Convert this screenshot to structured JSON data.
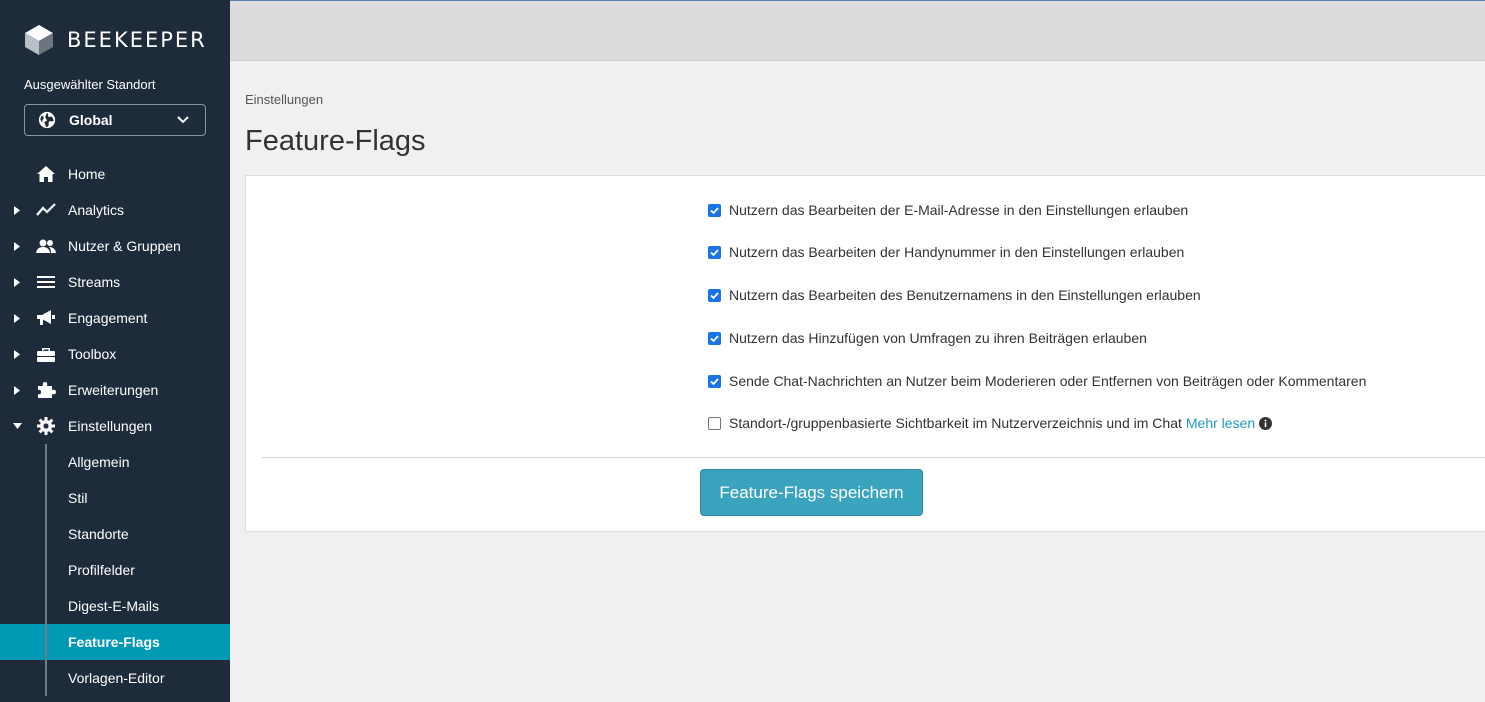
{
  "brand": {
    "name": "BEEKEEPER",
    "logo_icon": "cube-logo"
  },
  "location": {
    "label": "Ausgewählter Standort",
    "value": "Global"
  },
  "nav": [
    {
      "label": "Home",
      "icon": "home-icon"
    },
    {
      "label": "Analytics",
      "icon": "analytics-icon"
    },
    {
      "label": "Nutzer & Gruppen",
      "icon": "users-icon"
    },
    {
      "label": "Streams",
      "icon": "list-icon"
    },
    {
      "label": "Engagement",
      "icon": "megaphone-icon"
    },
    {
      "label": "Toolbox",
      "icon": "toolbox-icon"
    },
    {
      "label": "Erweiterungen",
      "icon": "puzzle-icon"
    },
    {
      "label": "Einstellungen",
      "icon": "gear-icon"
    }
  ],
  "subnav": [
    {
      "label": "Allgemein"
    },
    {
      "label": "Stil"
    },
    {
      "label": "Standorte"
    },
    {
      "label": "Profilfelder"
    },
    {
      "label": "Digest-E-Mails"
    },
    {
      "label": "Feature-Flags",
      "active": true
    },
    {
      "label": "Vorlagen-Editor"
    }
  ],
  "breadcrumb": "Einstellungen",
  "page_title": "Feature-Flags",
  "flags": [
    {
      "label": "Nutzern das Bearbeiten der E-Mail-Adresse in den Einstellungen erlauben",
      "checked": true
    },
    {
      "label": "Nutzern das Bearbeiten der Handynummer in den Einstellungen erlauben",
      "checked": true
    },
    {
      "label": "Nutzern das Bearbeiten des Benutzernamens in den Einstellungen erlauben",
      "checked": true
    },
    {
      "label": "Nutzern das Hinzufügen von Umfragen zu ihren Beiträgen erlauben",
      "checked": true
    },
    {
      "label": "Sende Chat-Nachrichten an Nutzer beim Moderieren oder Entfernen von Beiträgen oder Kommentaren",
      "checked": true
    },
    {
      "label": "Standort-/gruppenbasierte Sichtbarkeit im Nutzerverzeichnis und im Chat",
      "checked": false,
      "link": "Mehr lesen"
    }
  ],
  "save_label": "Feature-Flags speichern",
  "colors": {
    "sidebar": "#1d2b3a",
    "active": "#0099b4",
    "button": "#3aa3bd",
    "link": "#1f9cc4"
  }
}
